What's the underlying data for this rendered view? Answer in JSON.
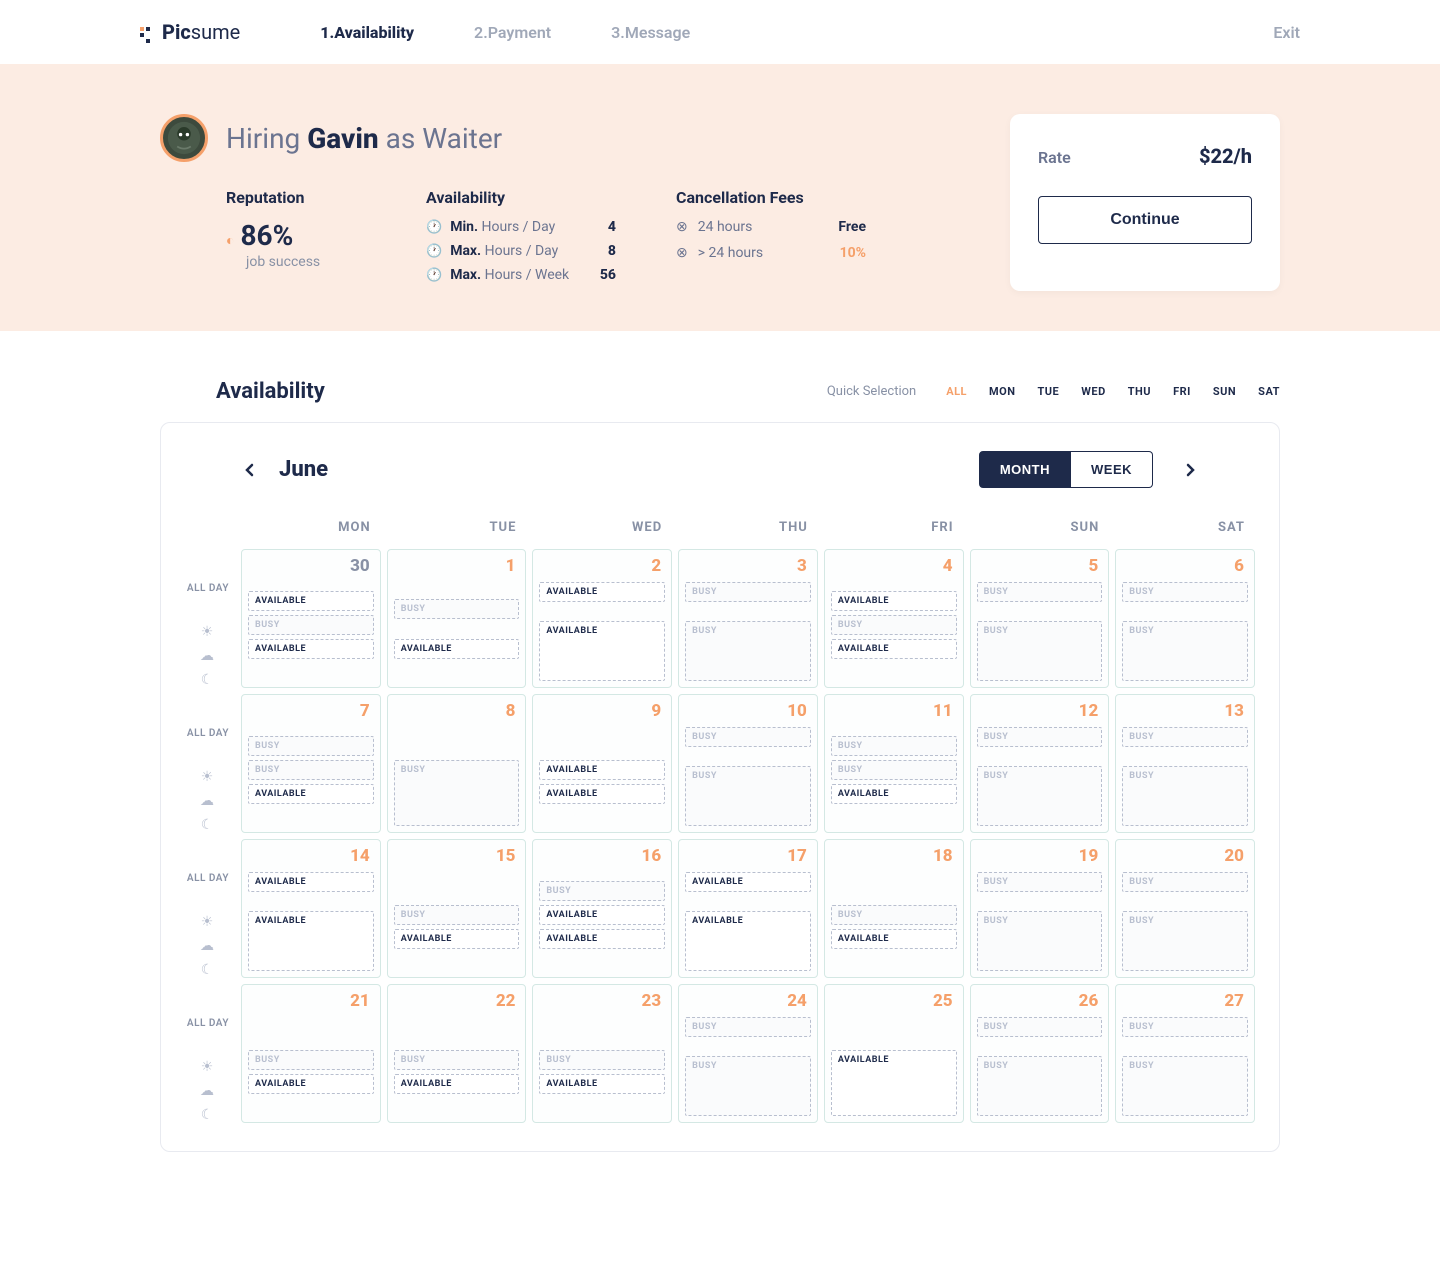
{
  "brand": {
    "bold": "Pic",
    "light": "sume"
  },
  "steps": [
    {
      "label": "1.Availability",
      "active": true
    },
    {
      "label": "2.Payment",
      "active": false
    },
    {
      "label": "3.Message",
      "active": false
    }
  ],
  "exit": "Exit",
  "hiring": {
    "prefix": "Hiring ",
    "name": "Gavin",
    "suffix": " as Waiter"
  },
  "reputation": {
    "title": "Reputation",
    "pct": "86%",
    "sub": "job success"
  },
  "availability": {
    "title": "Availability",
    "rows": [
      {
        "bold": "Min.",
        "rest": " Hours  / Day",
        "val": "4"
      },
      {
        "bold": "Max.",
        "rest": " Hours  / Day",
        "val": "8"
      },
      {
        "bold": "Max.",
        "rest": " Hours  / Week",
        "val": "56"
      }
    ]
  },
  "cancellation": {
    "title": "Cancellation Fees",
    "rows": [
      {
        "label": "24 hours",
        "val": "Free",
        "cls": "free"
      },
      {
        "label": "> 24 hours",
        "val": "10%",
        "cls": "pct"
      }
    ]
  },
  "rate": {
    "label": "Rate",
    "value": "$22/h",
    "button": "Continue"
  },
  "avail_section": {
    "title": "Availability",
    "quick_label": "Quick Selection"
  },
  "quick_days": [
    {
      "label": "ALL",
      "active": true
    },
    {
      "label": "MON"
    },
    {
      "label": "TUE"
    },
    {
      "label": "WED"
    },
    {
      "label": "THU"
    },
    {
      "label": "FRI"
    },
    {
      "label": "SUN"
    },
    {
      "label": "SAT"
    }
  ],
  "calendar": {
    "month": "June",
    "view": {
      "month": "MONTH",
      "week": "WEEK"
    },
    "day_headers": [
      "MON",
      "TUE",
      "WED",
      "THU",
      "FRI",
      "SUN",
      "SAT"
    ],
    "side": {
      "all_day": "ALL DAY"
    },
    "slot_labels": {
      "available": "AVAILABLE",
      "busy": "BUSY"
    },
    "weeks": [
      [
        {
          "num": "30",
          "prev": true,
          "slots": [
            {
              "spacer": true
            },
            {
              "t": "avail"
            },
            {
              "t": "busy"
            },
            {
              "t": "avail"
            }
          ]
        },
        {
          "num": "1",
          "slots": [
            {
              "spacer": true
            },
            {
              "t": "busy"
            },
            {
              "spacer": true
            },
            {
              "t": "avail"
            }
          ]
        },
        {
          "num": "2",
          "slots": [
            {
              "t": "avail"
            },
            {
              "spacer": true
            },
            {
              "t": "avail",
              "tall": true
            }
          ]
        },
        {
          "num": "3",
          "slots": [
            {
              "t": "busy"
            },
            {
              "spacer": true
            },
            {
              "t": "busy",
              "tall": true
            }
          ]
        },
        {
          "num": "4",
          "slots": [
            {
              "spacer": true
            },
            {
              "t": "avail"
            },
            {
              "t": "busy"
            },
            {
              "t": "avail"
            }
          ]
        },
        {
          "num": "5",
          "slots": [
            {
              "t": "busy"
            },
            {
              "spacer": true
            },
            {
              "t": "busy",
              "tall": true
            }
          ]
        },
        {
          "num": "6",
          "slots": [
            {
              "t": "busy"
            },
            {
              "spacer": true
            },
            {
              "t": "busy",
              "tall": true
            }
          ]
        }
      ],
      [
        {
          "num": "7",
          "slots": [
            {
              "spacer": true
            },
            {
              "t": "busy"
            },
            {
              "t": "busy"
            },
            {
              "t": "avail"
            }
          ]
        },
        {
          "num": "8",
          "slots": [
            {
              "spacer": true
            },
            {
              "spacer": true
            },
            {
              "t": "busy",
              "tall": true
            }
          ]
        },
        {
          "num": "9",
          "slots": [
            {
              "spacer": true
            },
            {
              "spacer": true
            },
            {
              "t": "avail"
            },
            {
              "t": "avail"
            }
          ]
        },
        {
          "num": "10",
          "slots": [
            {
              "t": "busy"
            },
            {
              "spacer": true
            },
            {
              "t": "busy",
              "tall": true
            }
          ]
        },
        {
          "num": "11",
          "slots": [
            {
              "spacer": true
            },
            {
              "t": "busy"
            },
            {
              "t": "busy"
            },
            {
              "t": "avail"
            }
          ]
        },
        {
          "num": "12",
          "slots": [
            {
              "t": "busy"
            },
            {
              "spacer": true
            },
            {
              "t": "busy",
              "tall": true
            }
          ]
        },
        {
          "num": "13",
          "slots": [
            {
              "t": "busy"
            },
            {
              "spacer": true
            },
            {
              "t": "busy",
              "tall": true
            }
          ]
        }
      ],
      [
        {
          "num": "14",
          "slots": [
            {
              "t": "avail"
            },
            {
              "spacer": true
            },
            {
              "t": "avail",
              "tall": true
            }
          ]
        },
        {
          "num": "15",
          "slots": [
            {
              "spacer": true
            },
            {
              "spacer": true
            },
            {
              "t": "busy"
            },
            {
              "t": "avail"
            }
          ]
        },
        {
          "num": "16",
          "slots": [
            {
              "spacer": true
            },
            {
              "t": "busy"
            },
            {
              "t": "avail"
            },
            {
              "t": "avail"
            }
          ]
        },
        {
          "num": "17",
          "slots": [
            {
              "t": "avail"
            },
            {
              "spacer": true
            },
            {
              "t": "avail",
              "tall": true
            }
          ]
        },
        {
          "num": "18",
          "slots": [
            {
              "spacer": true
            },
            {
              "spacer": true
            },
            {
              "t": "busy"
            },
            {
              "t": "avail"
            }
          ]
        },
        {
          "num": "19",
          "slots": [
            {
              "t": "busy"
            },
            {
              "spacer": true
            },
            {
              "t": "busy",
              "tall": true
            }
          ]
        },
        {
          "num": "20",
          "slots": [
            {
              "t": "busy"
            },
            {
              "spacer": true
            },
            {
              "t": "busy",
              "tall": true
            }
          ]
        }
      ],
      [
        {
          "num": "21",
          "slots": [
            {
              "spacer": true
            },
            {
              "spacer": true
            },
            {
              "t": "busy"
            },
            {
              "t": "avail"
            }
          ]
        },
        {
          "num": "22",
          "slots": [
            {
              "spacer": true
            },
            {
              "spacer": true
            },
            {
              "t": "busy"
            },
            {
              "t": "avail"
            }
          ]
        },
        {
          "num": "23",
          "slots": [
            {
              "spacer": true
            },
            {
              "spacer": true
            },
            {
              "t": "busy"
            },
            {
              "t": "avail"
            }
          ]
        },
        {
          "num": "24",
          "slots": [
            {
              "t": "busy"
            },
            {
              "spacer": true
            },
            {
              "t": "busy",
              "tall": true
            }
          ]
        },
        {
          "num": "25",
          "slots": [
            {
              "spacer": true
            },
            {
              "spacer": true
            },
            {
              "t": "avail",
              "tall": true
            }
          ]
        },
        {
          "num": "26",
          "slots": [
            {
              "t": "busy"
            },
            {
              "spacer": true
            },
            {
              "t": "busy",
              "tall": true
            }
          ]
        },
        {
          "num": "27",
          "slots": [
            {
              "t": "busy"
            },
            {
              "spacer": true
            },
            {
              "t": "busy",
              "tall": true
            }
          ]
        }
      ]
    ]
  }
}
